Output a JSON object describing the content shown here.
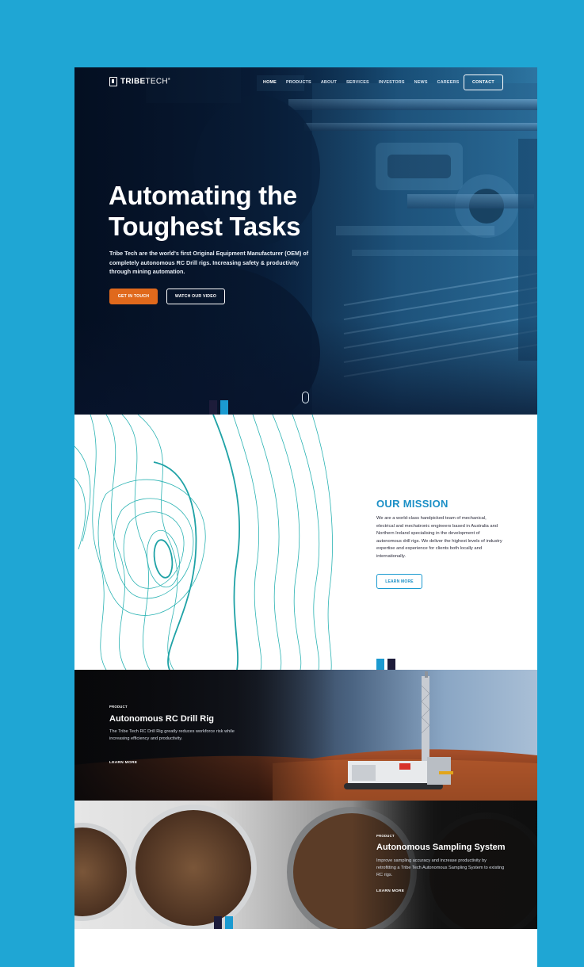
{
  "brand": {
    "name_bold": "TRIBE",
    "name_light": "TECH",
    "mark": "®"
  },
  "nav": {
    "items": [
      "HOME",
      "PRODUCTS",
      "ABOUT",
      "SERVICES",
      "INVESTORS",
      "NEWS",
      "CAREERS"
    ],
    "active": "HOME",
    "contact": "CONTACT"
  },
  "hero": {
    "title_line1": "Automating the",
    "title_line2": "Toughest Tasks",
    "subtitle": "Tribe Tech are the world's first Original Equipment Manufacturer (OEM) of completely autonomous RC Drill rigs.  Increasing safety & productivity through mining automation.",
    "primary_cta": "GET IN TOUCH",
    "secondary_cta": "WATCH OUR VIDEO"
  },
  "mission": {
    "title": "OUR MISSION",
    "body": "We are a world-class handpicked team of mechanical, electrical and mechatronic engineers based in Australia and Northern Ireland specialising in the development of autonomous drill rigs. We deliver the highest levels of industry expertise and experience for clients both locally and internationally.",
    "cta": "LEARN MORE"
  },
  "products": [
    {
      "eyebrow": "PRODUCT",
      "title": "Autonomous RC Drill Rig",
      "body": "The Tribe Tech RC Drill Rig greatly reduces workforce risk while increasing efficiency and productivity.",
      "cta": "LEARN MORE"
    },
    {
      "eyebrow": "PRODUCT",
      "title": "Autonomous Sampling System",
      "body": "Improve sampling accuracy and increase productivity by retrofitting a Tribe Tech Autonomous Sampling System to existing RC rigs.",
      "cta": "LEARN MORE"
    }
  ],
  "colors": {
    "background": "#1fa6d4",
    "accent_blue": "#1b8fc6",
    "accent_orange": "#e0691c",
    "navy": "#1d1c3a"
  }
}
